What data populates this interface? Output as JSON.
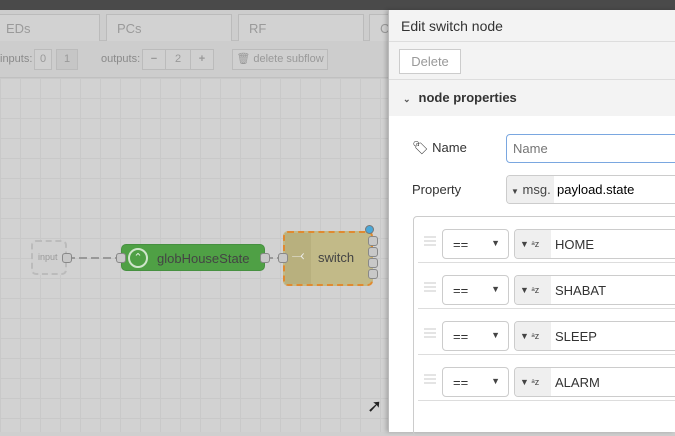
{
  "tabs": [
    "EDs",
    "PCs",
    "RF",
    "C"
  ],
  "toolbar": {
    "inputs_label": "inputs:",
    "inputs_options": [
      "0",
      "1"
    ],
    "outputs_label": "outputs:",
    "outputs_minus": "−",
    "outputs_value": "2",
    "outputs_plus": "+",
    "delete_subflow": "delete subflow"
  },
  "canvas": {
    "input_node": "input",
    "glob_node": "globHouseState",
    "switch_node": "switch"
  },
  "panel": {
    "title": "Edit switch node",
    "delete_button": "Delete",
    "section": "node properties",
    "name_label": "Name",
    "name_placeholder": "Name",
    "name_value": "",
    "property_label": "Property",
    "property_prefix": "msg.",
    "property_value": "payload.state",
    "rules": [
      {
        "op": "==",
        "value": "HOME"
      },
      {
        "op": "==",
        "value": "SHABAT"
      },
      {
        "op": "==",
        "value": "SLEEP"
      },
      {
        "op": "==",
        "value": "ALARM"
      }
    ]
  },
  "colors": {
    "glob_node": "#4fa045",
    "switch_node": "#c2ba88",
    "selected_outline": "#e08a30",
    "changed_dot": "#4aa8d8"
  }
}
